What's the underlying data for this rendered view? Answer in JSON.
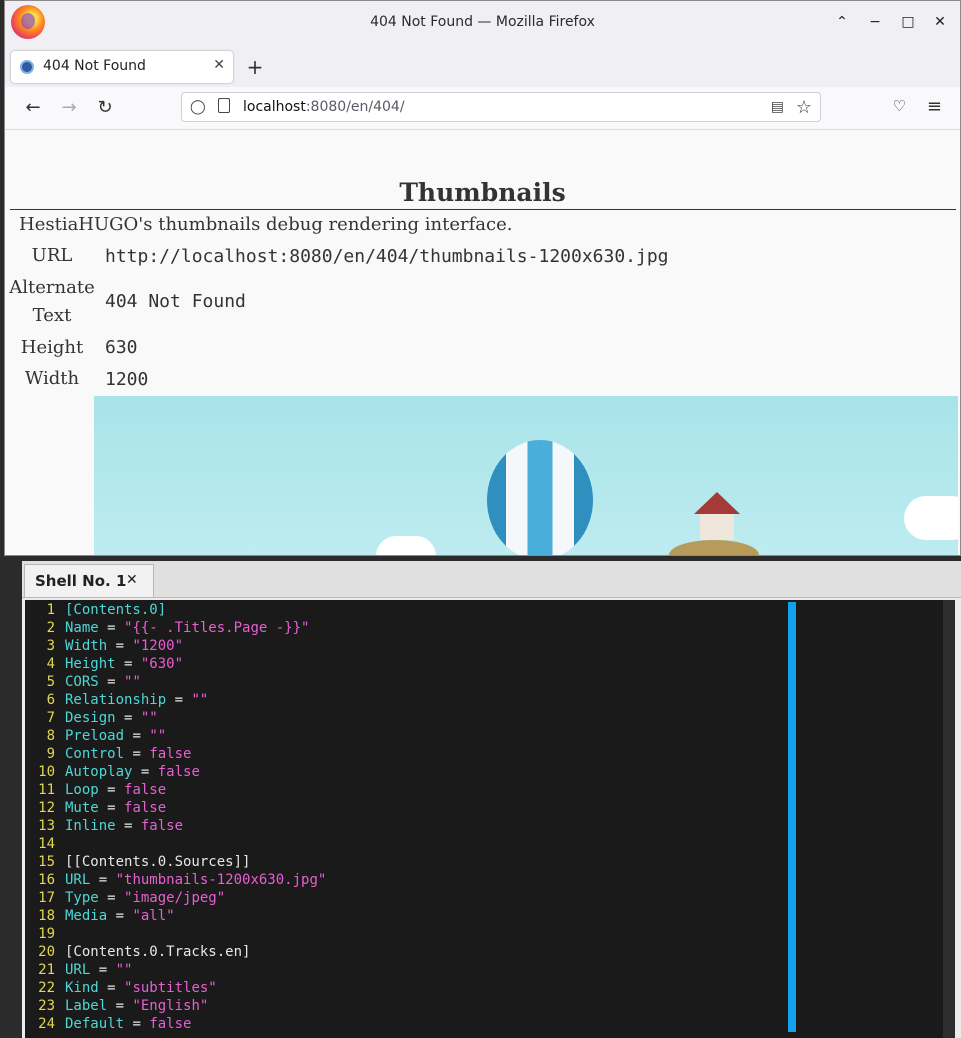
{
  "firefox": {
    "window_title": "404 Not Found — Mozilla Firefox",
    "tab_title": "404 Not Found",
    "url_host": "localhost",
    "url_path": ":8080/en/404/",
    "page": {
      "heading": "Thumbnails",
      "description": "HestiaHUGO's thumbnails debug rendering interface.",
      "fields": [
        {
          "label": "URL",
          "value": "http://localhost:8080/en/404/thumbnails-1200x630.jpg"
        },
        {
          "label": "Alternate Text",
          "value": "404 Not Found"
        },
        {
          "label": "Height",
          "value": "630"
        },
        {
          "label": "Width",
          "value": "1200"
        }
      ]
    }
  },
  "terminal": {
    "tab_label": "Shell No. 1",
    "lines": [
      {
        "n": "1",
        "parts": [
          [
            "[Contents.0]",
            "k"
          ]
        ]
      },
      {
        "n": "2",
        "parts": [
          [
            "Name",
            "k"
          ],
          [
            " = ",
            ""
          ],
          [
            "\"{{- .Titles.Page -}}\"",
            "s"
          ]
        ]
      },
      {
        "n": "3",
        "parts": [
          [
            "Width",
            "k"
          ],
          [
            " = ",
            ""
          ],
          [
            "\"1200\"",
            "s"
          ]
        ]
      },
      {
        "n": "4",
        "parts": [
          [
            "Height",
            "k"
          ],
          [
            " = ",
            ""
          ],
          [
            "\"630\"",
            "s"
          ]
        ]
      },
      {
        "n": "5",
        "parts": [
          [
            "CORS",
            "k"
          ],
          [
            " = ",
            ""
          ],
          [
            "\"\"",
            "s"
          ]
        ]
      },
      {
        "n": "6",
        "parts": [
          [
            "Relationship",
            "k"
          ],
          [
            " = ",
            ""
          ],
          [
            "\"\"",
            "s"
          ]
        ]
      },
      {
        "n": "7",
        "parts": [
          [
            "Design",
            "k"
          ],
          [
            " = ",
            ""
          ],
          [
            "\"\"",
            "s"
          ]
        ]
      },
      {
        "n": "8",
        "parts": [
          [
            "Preload",
            "k"
          ],
          [
            " = ",
            ""
          ],
          [
            "\"\"",
            "s"
          ]
        ]
      },
      {
        "n": "9",
        "parts": [
          [
            "Control",
            "k"
          ],
          [
            " = ",
            ""
          ],
          [
            "false",
            "b"
          ]
        ]
      },
      {
        "n": "10",
        "parts": [
          [
            "Autoplay",
            "k"
          ],
          [
            " = ",
            ""
          ],
          [
            "false",
            "b"
          ]
        ]
      },
      {
        "n": "11",
        "parts": [
          [
            "Loop",
            "k"
          ],
          [
            " = ",
            ""
          ],
          [
            "false",
            "b"
          ]
        ]
      },
      {
        "n": "12",
        "parts": [
          [
            "Mute",
            "k"
          ],
          [
            " = ",
            ""
          ],
          [
            "false",
            "b"
          ]
        ]
      },
      {
        "n": "13",
        "parts": [
          [
            "Inline",
            "k"
          ],
          [
            " = ",
            ""
          ],
          [
            "false",
            "b"
          ]
        ]
      },
      {
        "n": "14",
        "parts": []
      },
      {
        "n": "15",
        "parts": [
          [
            "[[Contents.0.Sources]]",
            ""
          ]
        ]
      },
      {
        "n": "16",
        "parts": [
          [
            "URL",
            "k"
          ],
          [
            " = ",
            ""
          ],
          [
            "\"thumbnails-1200x630.jpg\"",
            "s"
          ]
        ]
      },
      {
        "n": "17",
        "parts": [
          [
            "Type",
            "k"
          ],
          [
            " = ",
            ""
          ],
          [
            "\"image/jpeg\"",
            "s"
          ]
        ]
      },
      {
        "n": "18",
        "parts": [
          [
            "Media",
            "k"
          ],
          [
            " = ",
            ""
          ],
          [
            "\"all\"",
            "s"
          ]
        ]
      },
      {
        "n": "19",
        "parts": []
      },
      {
        "n": "20",
        "parts": [
          [
            "[Contents.0.Tracks.en]",
            ""
          ]
        ]
      },
      {
        "n": "21",
        "parts": [
          [
            "URL",
            "k"
          ],
          [
            " = ",
            ""
          ],
          [
            "\"\"",
            "s"
          ]
        ]
      },
      {
        "n": "22",
        "parts": [
          [
            "Kind",
            "k"
          ],
          [
            " = ",
            ""
          ],
          [
            "\"subtitles\"",
            "s"
          ]
        ]
      },
      {
        "n": "23",
        "parts": [
          [
            "Label",
            "k"
          ],
          [
            " = ",
            ""
          ],
          [
            "\"English\"",
            "s"
          ]
        ]
      },
      {
        "n": "24",
        "parts": [
          [
            "Default",
            "k"
          ],
          [
            " = ",
            ""
          ],
          [
            "false",
            "b"
          ]
        ]
      }
    ]
  },
  "colors": {
    "keyword": "#4fd7d7",
    "string": "#e85fd2",
    "line_number": "#e3d94e",
    "cursor_bar": "#12a0ef"
  }
}
